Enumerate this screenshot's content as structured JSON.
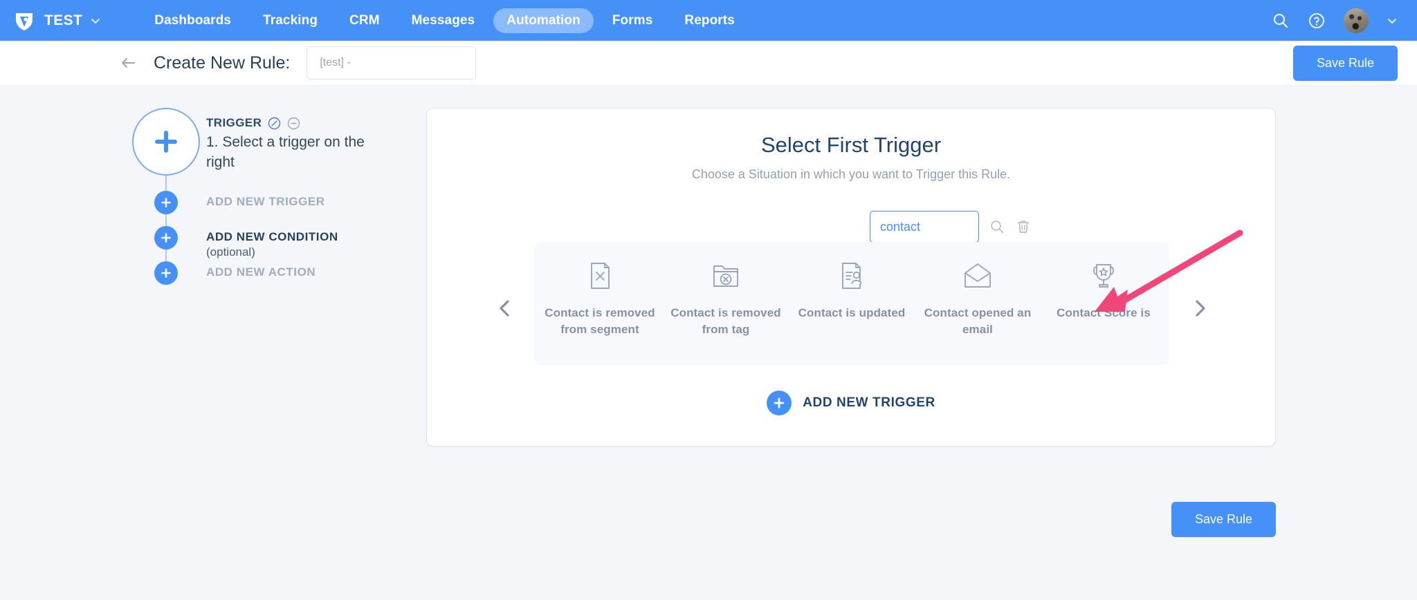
{
  "topnav": {
    "logo_icon": "shield-logo-icon",
    "brand": "TEST",
    "brand_caret_icon": "chevron-down-icon",
    "links": [
      {
        "label": "Dashboards",
        "active": false
      },
      {
        "label": "Tracking",
        "active": false
      },
      {
        "label": "CRM",
        "active": false
      },
      {
        "label": "Messages",
        "active": false
      },
      {
        "label": "Automation",
        "active": true
      },
      {
        "label": "Forms",
        "active": false
      },
      {
        "label": "Reports",
        "active": false
      }
    ],
    "search_icon": "search-icon",
    "help_icon": "help-circle-icon",
    "avatar_icon": "user-avatar",
    "avatar_caret_icon": "chevron-down-icon",
    "background_color": "#4591f7",
    "active_pill_color": "#8cbaff"
  },
  "subheader": {
    "back_icon": "arrow-left-icon",
    "title": "Create New Rule:",
    "rule_name_value": "[test] -",
    "rule_name_placeholder": "Rule name",
    "save_label": "Save Rule"
  },
  "steps": {
    "trigger": {
      "label": "TRIGGER",
      "edit_icon": "edit-circle-icon",
      "remove_icon": "minus-circle-icon",
      "description": "1. Select a trigger on the right",
      "node_icon": "plus-icon"
    },
    "rail": [
      {
        "label": "ADD NEW TRIGGER",
        "sub": "",
        "emphasis": "muted",
        "node_icon": "plus-icon"
      },
      {
        "label": "ADD NEW CONDITION",
        "sub": "(optional)",
        "emphasis": "dark",
        "node_icon": "plus-icon"
      },
      {
        "label": "ADD NEW ACTION",
        "sub": "",
        "emphasis": "muted",
        "node_icon": "plus-icon"
      }
    ]
  },
  "main": {
    "title": "Select First Trigger",
    "subtitle": "Choose a Situation in which you want to Trigger this Rule.",
    "search": {
      "value": "contact ",
      "placeholder": "Search",
      "search_icon": "search-icon",
      "delete_icon": "trash-icon"
    },
    "carousel": {
      "prev_icon": "chevron-left-icon",
      "next_icon": "chevron-right-icon",
      "tiles": [
        {
          "label": "Contact is removed from segment",
          "icon": "document-x-icon"
        },
        {
          "label": "Contact is removed from tag",
          "icon": "folder-x-icon"
        },
        {
          "label": "Contact is updated",
          "icon": "document-person-icon"
        },
        {
          "label": "Contact opened an email",
          "icon": "open-envelope-icon"
        },
        {
          "label": "Contact Score is",
          "icon": "trophy-star-icon"
        }
      ]
    },
    "add_trigger": {
      "label": "ADD NEW TRIGGER",
      "icon": "plus-circle-icon"
    },
    "save_label": "Save Rule"
  },
  "annotation": {
    "arrow_icon": "pink-pointer-arrow",
    "color": "#f0467a"
  },
  "colors": {
    "accent": "#4591f7",
    "page_background": "#f4f6fa",
    "card_background": "#ffffff",
    "tile_panel": "#f7f9fc",
    "muted_text": "#8791a6",
    "heading_text": "#1f4470"
  }
}
